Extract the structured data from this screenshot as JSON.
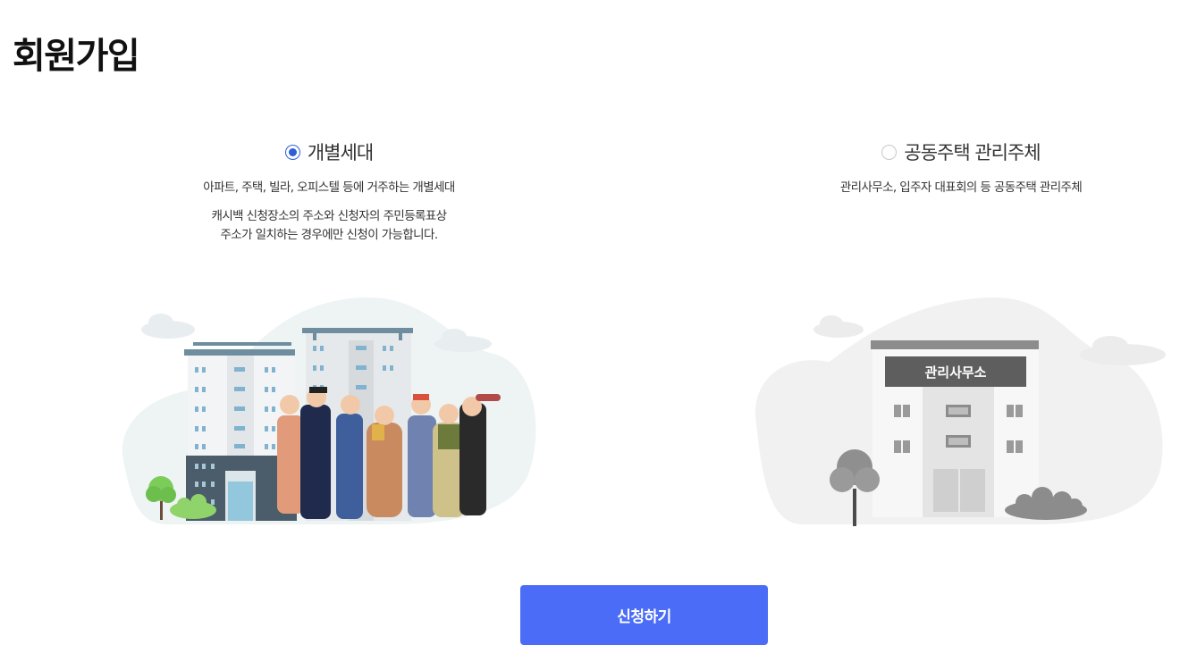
{
  "page": {
    "title": "회원가입"
  },
  "options": [
    {
      "label": "개별세대",
      "selected": true,
      "description": "아파트, 주택, 빌라, 오피스텔 등에 거주하는 개별세대",
      "notes": [
        "캐시백 신청장소의 주소와 신청자의 주민등록표상",
        "주소가 일치하는 경우에만 신청이 가능합니다."
      ],
      "illustration": "apartment-residents-illustration"
    },
    {
      "label": "공동주택 관리주체",
      "selected": false,
      "description": "관리사무소, 입주자 대표회의 등 공동주택 관리주체",
      "illustration": "management-office-illustration",
      "sign_text": "관리사무소"
    }
  ],
  "apply_button": {
    "label": "신청하기"
  },
  "colors": {
    "accent": "#4a6cf7",
    "radio_selected": "#2f5fd6",
    "building_blue": "#6e8ea0",
    "tree_green": "#7ccc5a"
  }
}
